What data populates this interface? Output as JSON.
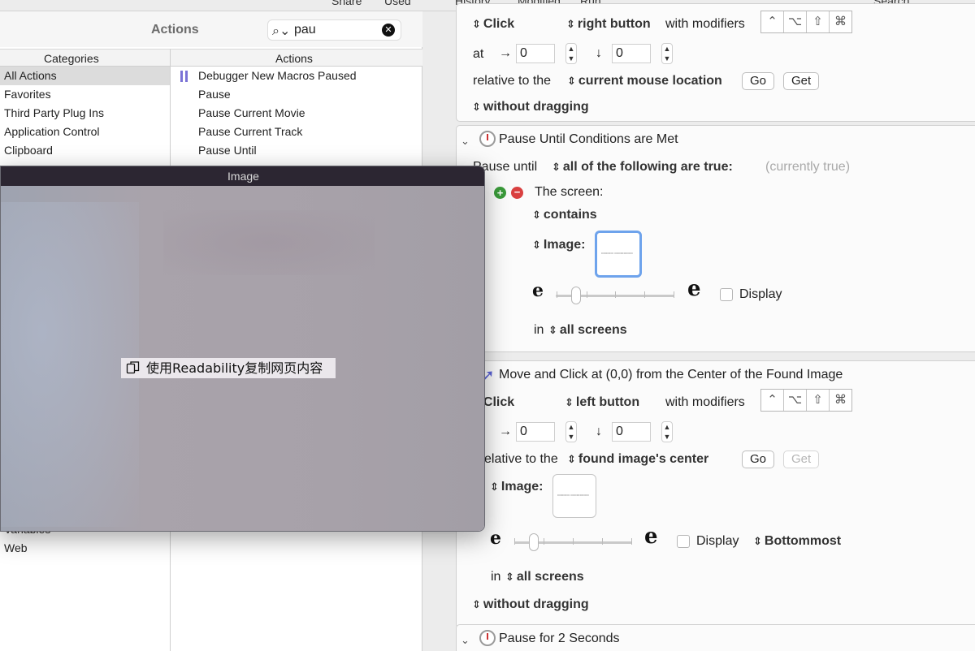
{
  "toolbar": {
    "share": "Share",
    "used": "Used",
    "history": "History",
    "modified": "Modified",
    "run": "Run",
    "search": "Search"
  },
  "library": {
    "title": "Actions",
    "search_value": "pau",
    "columns": {
      "categories": "Categories",
      "actions": "Actions"
    },
    "categories": [
      "All Actions",
      "Favorites",
      "Third Party Plug Ins",
      "Application Control",
      "Clipboard"
    ],
    "categories_bottom": [
      "Variables",
      "Web"
    ],
    "actions": [
      "Debugger New Macros Paused",
      "Pause",
      "Pause Current Movie",
      "Pause Current Track",
      "Pause Until"
    ]
  },
  "image_window": {
    "title": "Image",
    "content_text": "使用Readability复制网页内容"
  },
  "click_action": {
    "click": "Click",
    "button": "right button",
    "with_modifiers": "with modifiers",
    "at": "at",
    "x": "0",
    "y": "0",
    "relative_to": "relative to the",
    "relative_value": "current mouse location",
    "go": "Go",
    "get": "Get",
    "dragging": "without dragging"
  },
  "pause_until": {
    "title": "Pause Until Conditions are Met",
    "pause_until": "Pause until",
    "condition": "all of the following are true:",
    "status": "(currently true)",
    "the_screen": "The screen:",
    "contains": "contains",
    "image_label": "Image:",
    "display": "Display",
    "in": "in",
    "screens": "all screens"
  },
  "move_click": {
    "title": "Move and Click at (0,0) from the Center of the Found Image",
    "click": "Click",
    "button": "left button",
    "with_modifiers": "with modifiers",
    "x": "0",
    "y": "0",
    "relative_to": "elative to the",
    "relative_value": "found image's center",
    "go": "Go",
    "get": "Get",
    "image_label": "Image:",
    "display": "Display",
    "order": "Bottommost",
    "in": "in",
    "screens": "all screens",
    "dragging": "without dragging"
  },
  "pause_seconds": {
    "title": "Pause for 2 Seconds"
  },
  "modifier_keys": [
    "⌃",
    "⌥",
    "⇧",
    "⌘"
  ],
  "colors": {
    "accent": "#6ea3ec",
    "debug": "#7b73d6"
  }
}
